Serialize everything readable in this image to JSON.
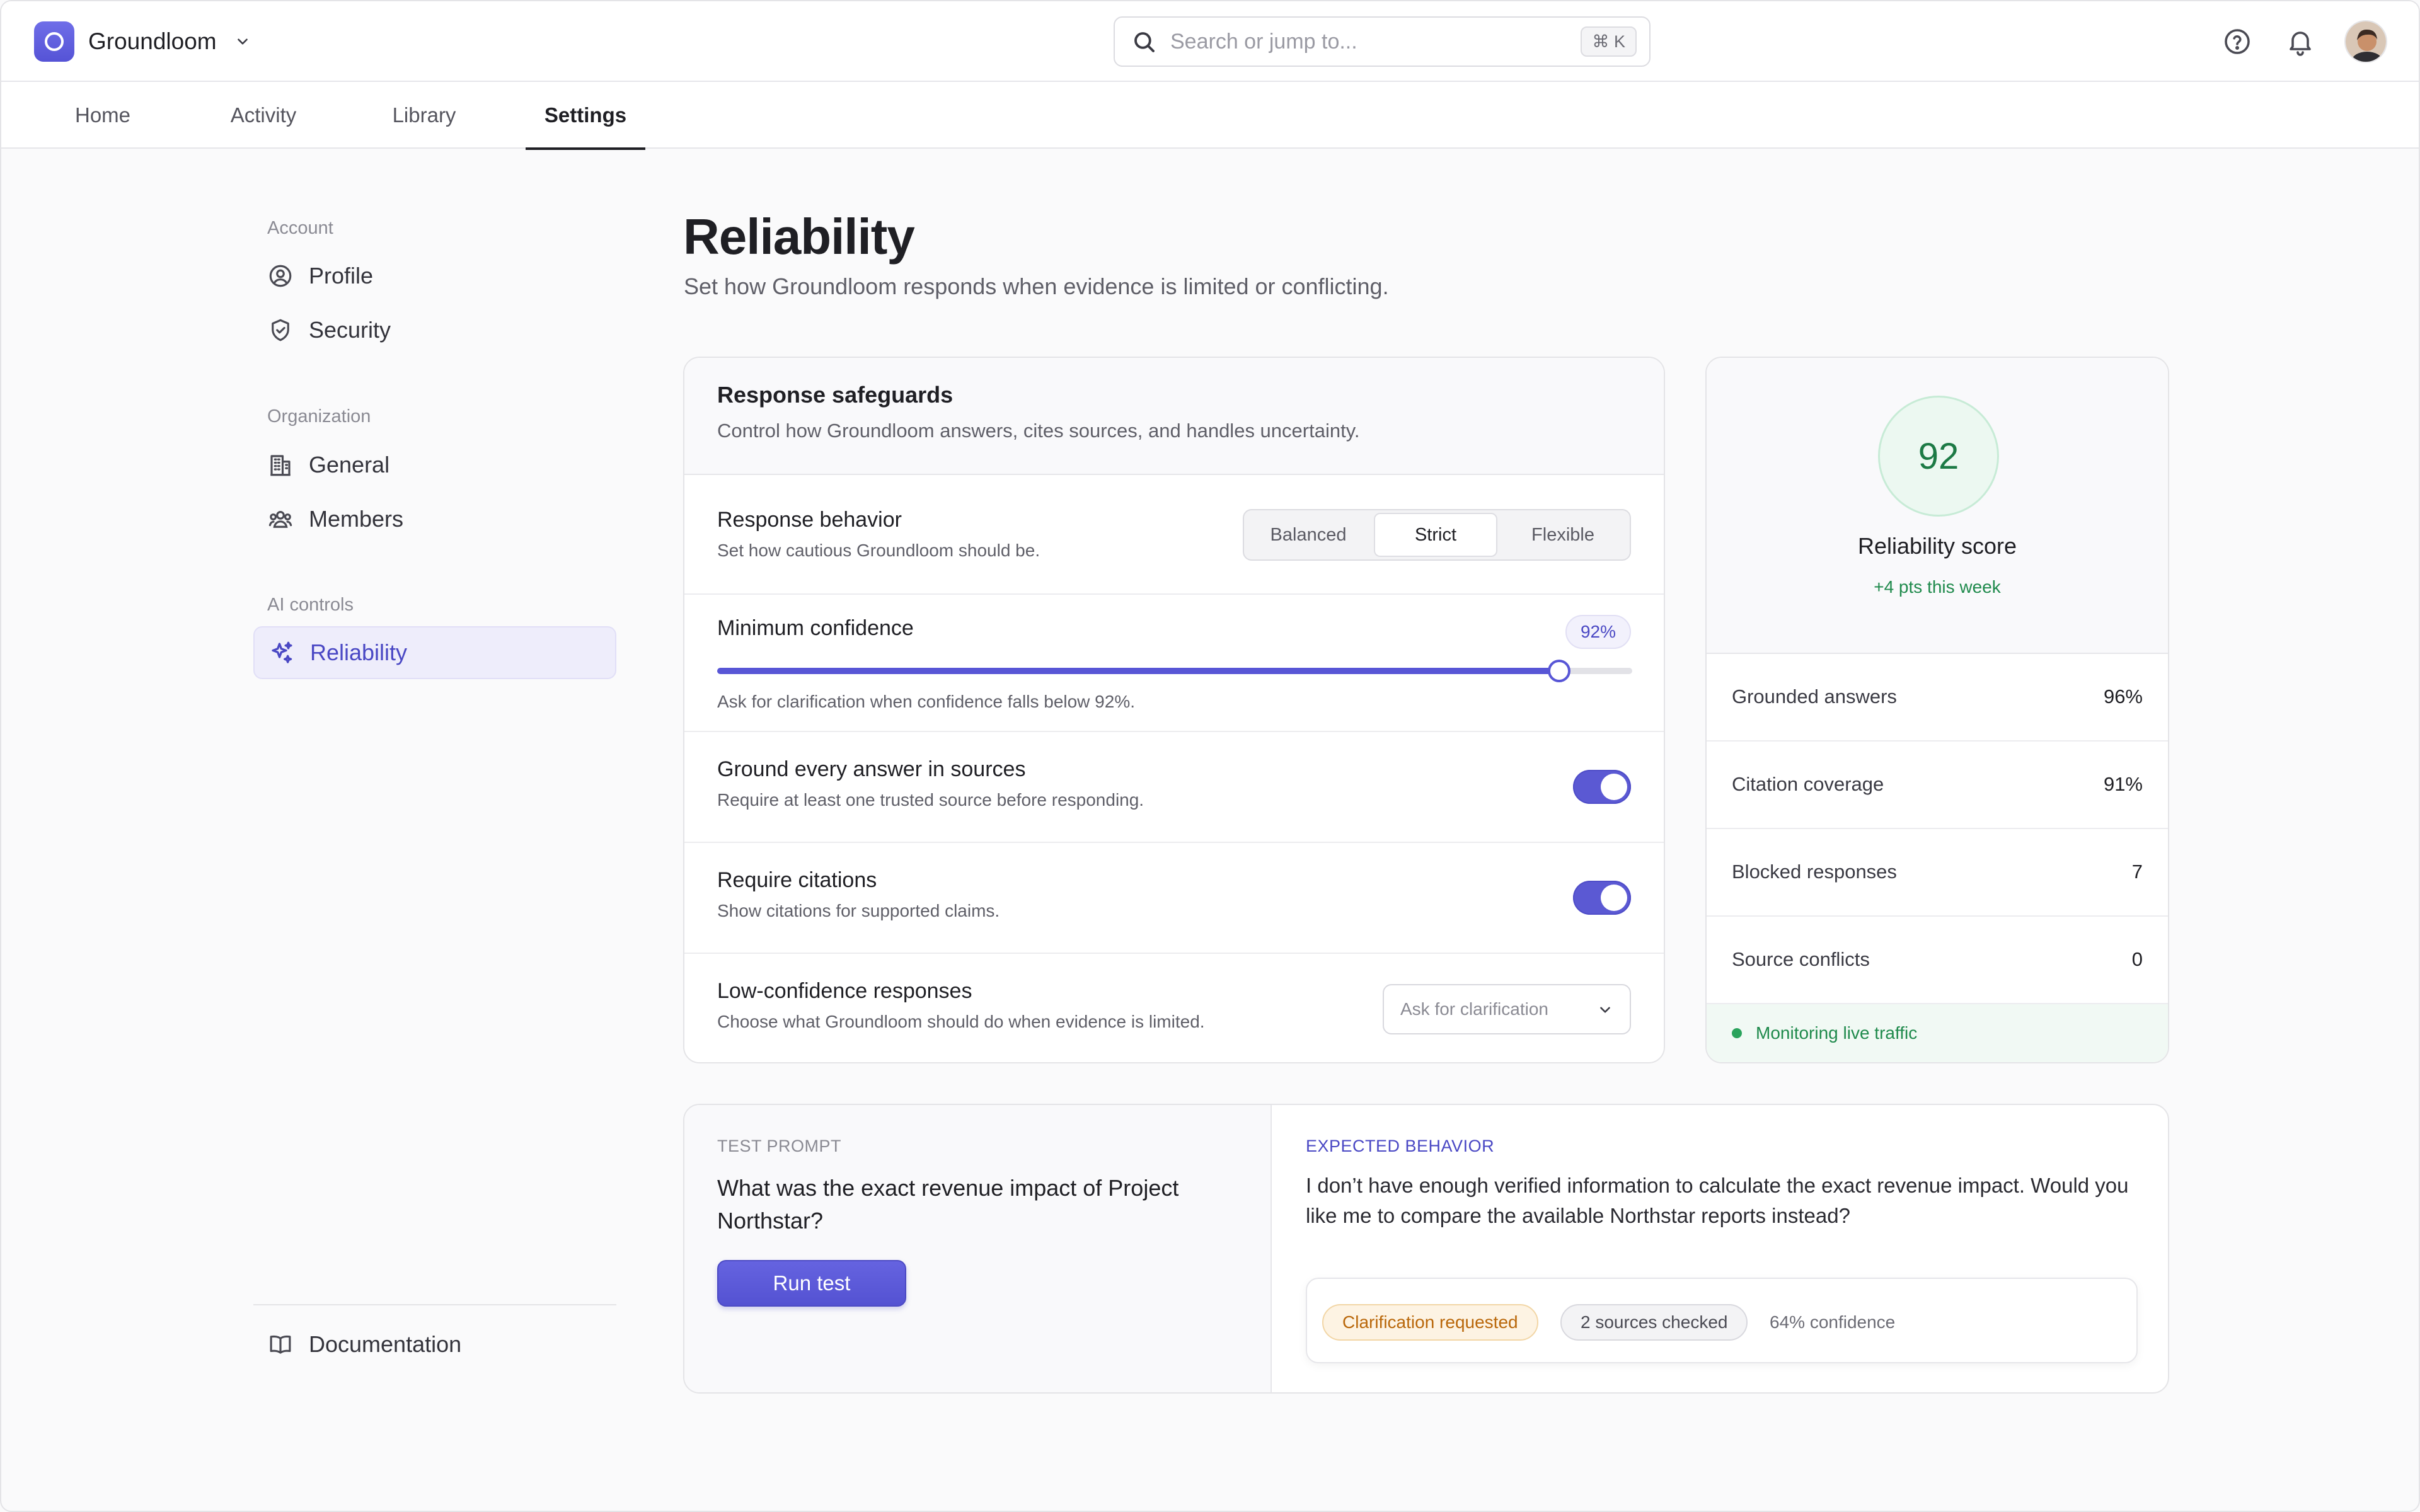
{
  "app": {
    "name": "Groundloom",
    "search_placeholder": "Search or jump to...",
    "search_shortcut": "⌘ K",
    "icons": [
      "chevron-down-icon",
      "search-icon",
      "help-icon",
      "bell-icon"
    ]
  },
  "tabs": [
    {
      "label": "Home",
      "active": false
    },
    {
      "label": "Activity",
      "active": false
    },
    {
      "label": "Library",
      "active": false
    },
    {
      "label": "Settings",
      "active": true
    }
  ],
  "sidebar": {
    "groups": [
      {
        "heading": "Account",
        "items": [
          {
            "label": "Profile",
            "icon": "user-circle-icon"
          },
          {
            "label": "Security",
            "icon": "shield-check-icon"
          }
        ]
      },
      {
        "heading": "Organization",
        "items": [
          {
            "label": "General",
            "icon": "building-icon"
          },
          {
            "label": "Members",
            "icon": "users-icon"
          }
        ]
      },
      {
        "heading": "AI controls",
        "items": [
          {
            "label": "Reliability",
            "icon": "sparkles-icon",
            "active": true
          }
        ]
      }
    ],
    "footer_item": {
      "label": "Documentation",
      "icon": "book-icon"
    }
  },
  "page": {
    "title": "Reliability",
    "subtitle": "Set how Groundloom responds when evidence is limited or conflicting."
  },
  "safeguards": {
    "title": "Response safeguards",
    "subtitle": "Control how Groundloom answers, cites sources, and handles uncertainty.",
    "behavior": {
      "title": "Response behavior",
      "desc": "Set how cautious Groundloom should be.",
      "options": [
        "Balanced",
        "Strict",
        "Flexible"
      ],
      "selected": "Strict"
    },
    "confidence": {
      "title": "Minimum confidence",
      "value_label": "92%",
      "value": 0.92,
      "desc": "Ask for clarification when confidence falls below 92%."
    },
    "ground": {
      "title": "Ground every answer in sources",
      "desc": "Require at least one trusted source before responding.",
      "enabled": true
    },
    "citations": {
      "title": "Require citations",
      "desc": "Show citations for supported claims.",
      "enabled": true
    },
    "low_confidence": {
      "title": "Low-confidence responses",
      "desc": "Choose what Groundloom should do when evidence is limited.",
      "selected": "Ask for clarification"
    }
  },
  "score": {
    "value": "92",
    "label": "Reliability score",
    "delta": "+4 pts this week",
    "metrics": [
      {
        "label": "Grounded answers",
        "value": "96%"
      },
      {
        "label": "Citation coverage",
        "value": "91%"
      },
      {
        "label": "Blocked responses",
        "value": "7"
      },
      {
        "label": "Source conflicts",
        "value": "0"
      }
    ],
    "status": "Monitoring live traffic"
  },
  "test": {
    "prompt_label": "TEST PROMPT",
    "prompt": "What was the exact revenue impact of Project Northstar?",
    "run_label": "Run test",
    "expected_label": "EXPECTED BEHAVIOR",
    "expected": "I don’t have enough verified information to calculate the exact revenue impact. Would you like me to compare the available Northstar reports instead?",
    "chips": {
      "warn": "Clarification requested",
      "neutral": "2 sources checked",
      "plain": "64% confidence"
    }
  },
  "colors": {
    "accent": "#5856d6",
    "success": "#1f8a4c",
    "warning": "#b9670a"
  }
}
